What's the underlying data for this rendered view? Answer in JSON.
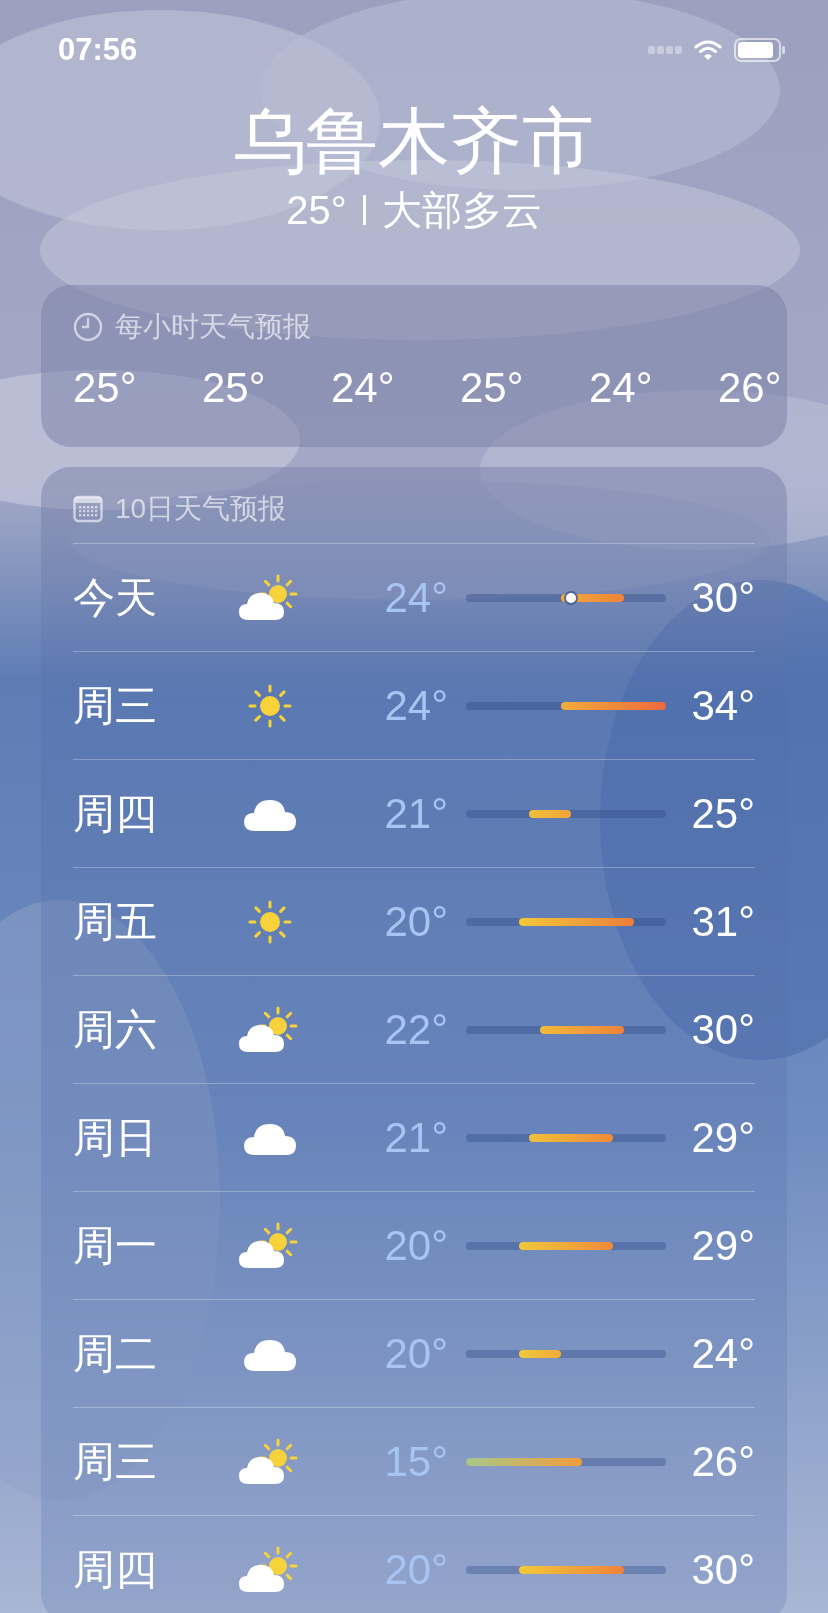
{
  "status_bar": {
    "time": "07:56"
  },
  "location": {
    "city": "乌鲁木齐市",
    "temperature": "25°",
    "condition": "大部多云"
  },
  "hourly": {
    "title": "每小时天气预报",
    "temperatures": [
      "25°",
      "25°",
      "24°",
      "25°",
      "24°",
      "26°"
    ]
  },
  "daily": {
    "title": "10日天气预报",
    "days": [
      {
        "day": "今天",
        "kind": "partly-cloudy",
        "low": "24°",
        "high": "30°",
        "current": true
      },
      {
        "day": "周三",
        "kind": "sunny",
        "low": "24°",
        "high": "34°",
        "current": false
      },
      {
        "day": "周四",
        "kind": "cloudy",
        "low": "21°",
        "high": "25°",
        "current": false
      },
      {
        "day": "周五",
        "kind": "sunny",
        "low": "20°",
        "high": "31°",
        "current": false
      },
      {
        "day": "周六",
        "kind": "partly-cloudy",
        "low": "22°",
        "high": "30°",
        "current": false
      },
      {
        "day": "周日",
        "kind": "cloudy",
        "low": "21°",
        "high": "29°",
        "current": false
      },
      {
        "day": "周一",
        "kind": "partly-cloudy",
        "low": "20°",
        "high": "29°",
        "current": false
      },
      {
        "day": "周二",
        "kind": "cloudy",
        "low": "20°",
        "high": "24°",
        "current": false
      },
      {
        "day": "周三",
        "kind": "partly-cloudy",
        "low": "15°",
        "high": "26°",
        "current": false
      },
      {
        "day": "周四",
        "kind": "partly-cloudy",
        "low": "20°",
        "high": "30°",
        "current": false
      }
    ]
  }
}
